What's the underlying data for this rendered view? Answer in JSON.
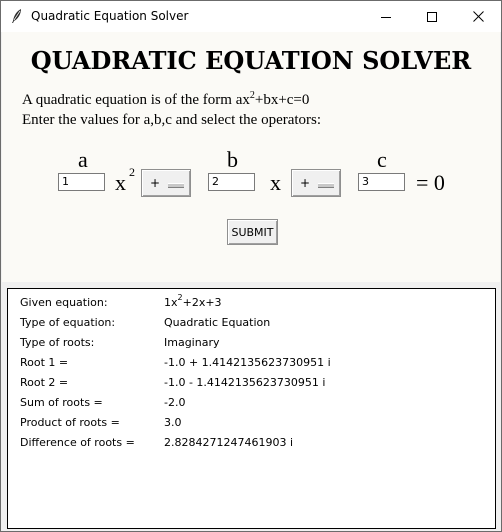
{
  "window": {
    "title": "Quadratic Equation Solver",
    "controls": [
      "minimize",
      "maximize",
      "close"
    ]
  },
  "header": {
    "title": "QUADRATIC EQUATION SOLVER",
    "line1_prefix": "A quadratic equation is of the form ax",
    "line1_sup": "2",
    "line1_suffix": "+bx+c=0",
    "line2": "Enter the values for a,b,c and select the operators:"
  },
  "form": {
    "label_a": "a",
    "label_b": "b",
    "label_c": "c",
    "value_a": "1",
    "value_b": "2",
    "value_c": "3",
    "x_squared_var": "x",
    "x_squared_exp": "2",
    "x_var": "x",
    "operator_1": "+",
    "operator_2": "+",
    "equals_zero": "= 0",
    "submit_label": "SUBMIT"
  },
  "results": {
    "given_equation": {
      "label": "Given equation:",
      "value_coef": "1x",
      "value_exp": "2",
      "value_rest": "+2x+3"
    },
    "rows": [
      {
        "label": "Type of equation:",
        "value": "Quadratic Equation"
      },
      {
        "label": "Type of roots:",
        "value": "Imaginary"
      },
      {
        "label": "Root 1 =",
        "value": "-1.0 + 1.4142135623730951 i"
      },
      {
        "label": "Root 2 =",
        "value": "-1.0 - 1.4142135623730951 i"
      },
      {
        "label": "Sum of roots =",
        "value": "-2.0"
      },
      {
        "label": "Product of roots =",
        "value": "3.0"
      },
      {
        "label": "Difference of roots =",
        "value": "2.8284271247461903 i"
      }
    ]
  },
  "colors": {
    "window_bg": "#f0f0f0",
    "form_bg": "#fbfaf6",
    "results_bg": "#ffffff",
    "text": "#000000"
  }
}
